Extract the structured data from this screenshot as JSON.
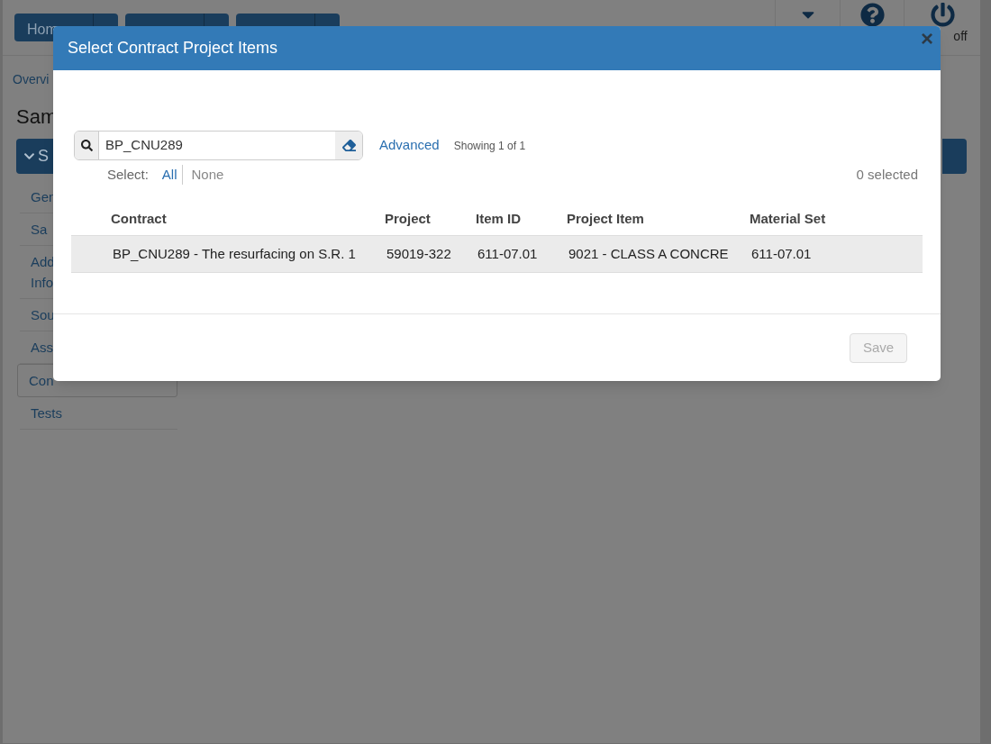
{
  "background": {
    "nav_buttons": [
      {
        "kind": "labeled",
        "label": "Hom"
      },
      {
        "kind": "blank"
      },
      {
        "kind": "blank"
      }
    ],
    "logoff": "off",
    "breadcrumb": "Overvi",
    "title": "Sam",
    "section": "S",
    "side_items": [
      {
        "lines": [
          "Gen"
        ],
        "selected": false
      },
      {
        "lines": [
          "Sa"
        ],
        "selected": false
      },
      {
        "lines": [
          "Add",
          "Info"
        ],
        "selected": false
      },
      {
        "lines": [
          "Sou"
        ],
        "selected": false
      },
      {
        "lines": [
          "Ass"
        ],
        "selected": false
      },
      {
        "lines": [
          "Con"
        ],
        "selected": true
      },
      {
        "lines": [
          "Tests"
        ],
        "selected": false
      }
    ]
  },
  "dialog": {
    "title": "Select Contract Project Items",
    "close": "×",
    "search": {
      "value": "BP_CNU289"
    },
    "advanced": "Advanced",
    "showing": "Showing 1 of 1",
    "select_label": "Select:",
    "select_options": [
      {
        "label": "All",
        "disabled": false
      },
      {
        "label": "None",
        "disabled": true
      }
    ],
    "selected_count": "0 selected",
    "columns": [
      "Contract",
      "Project",
      "Item ID",
      "Project Item",
      "Material Set"
    ],
    "rows": [
      {
        "cells": [
          "BP_CNU289 - The resurfacing on S.R. 1",
          "59019-322",
          "611-07.01",
          "9021 - CLASS A CONCRE",
          "611-07.01"
        ]
      }
    ],
    "save": {
      "label": "Save",
      "disabled": true
    }
  }
}
